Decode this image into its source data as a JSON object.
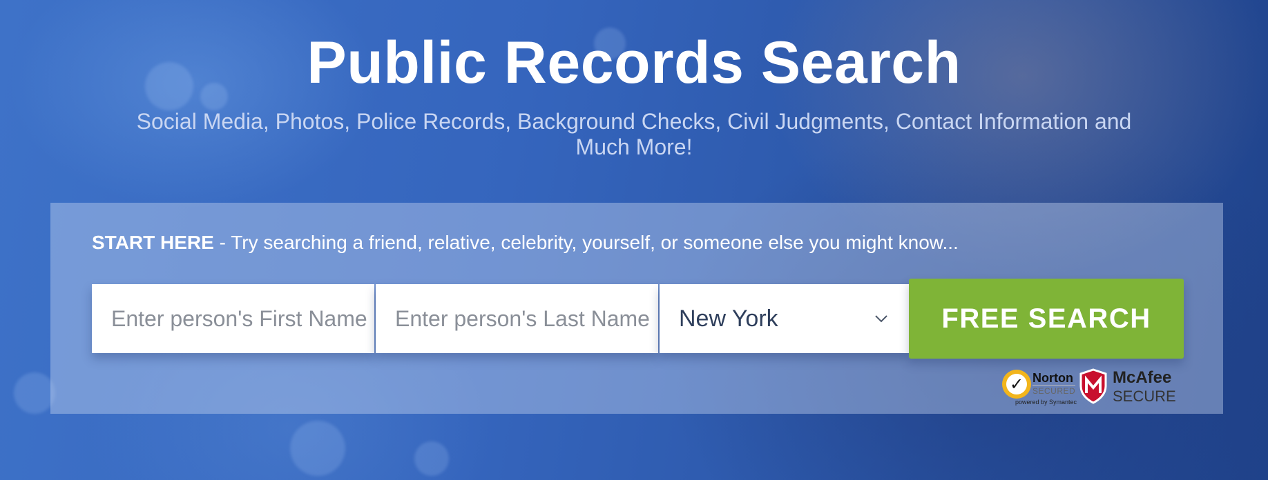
{
  "hero": {
    "title": "Public Records Search",
    "subtitle": "Social Media, Photos, Police Records, Background Checks, Civil Judgments, Contact Information and Much More!"
  },
  "search_panel": {
    "prompt_strong": "START HERE",
    "prompt_rest": " - Try searching a friend, relative, celebrity, yourself, or someone else you might know...",
    "first_name_placeholder": "Enter person's First Name",
    "last_name_placeholder": "Enter person's Last Name",
    "state_selected": "New York",
    "button_label": "FREE SEARCH",
    "button_color": "#7fb437"
  },
  "badges": {
    "norton_name": "Norton",
    "norton_status": "SECURED",
    "norton_powered": "powered by Symantec",
    "mcafee_name": "McAfee",
    "mcafee_status": "SECURE",
    "norton_icon": "checkmark-icon",
    "mcafee_icon": "shield-icon"
  }
}
